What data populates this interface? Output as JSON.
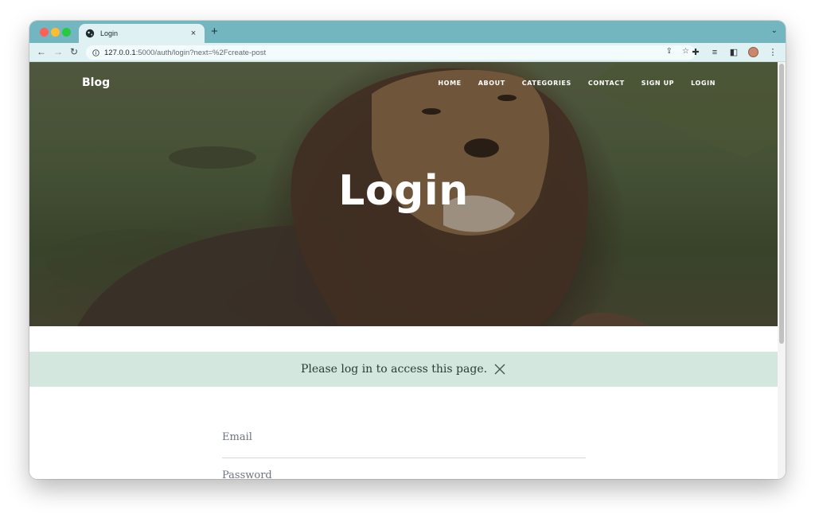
{
  "browser": {
    "tab_title": "Login",
    "tab_close": "×",
    "new_tab": "+",
    "tab_menu": "⌄",
    "url_host": "127.0.0.1",
    "url_rest": ":5000/auth/login?next=%2Fcreate-post",
    "icons": {
      "back": "arrow-left-icon",
      "forward": "arrow-right-icon",
      "reload": "reload-icon",
      "share": "share-icon",
      "bookmark": "star-icon",
      "extensions": "puzzle-icon",
      "reading_list": "reading-list-icon",
      "side_panel": "side-panel-icon",
      "menu": "kebab-menu-icon"
    }
  },
  "site": {
    "brand": "Blog",
    "nav": [
      "HOME",
      "ABOUT",
      "CATEGORIES",
      "CONTACT",
      "SIGN UP",
      "LOGIN"
    ],
    "hero_title": "Login"
  },
  "alert": {
    "message": "Please log in to access this page.",
    "color": "#d3e7df"
  },
  "form": {
    "email_label": "Email",
    "password_label": "Password"
  },
  "colors": {
    "browser_frame": "#74b6bf",
    "toolbar": "#dff1f3"
  }
}
